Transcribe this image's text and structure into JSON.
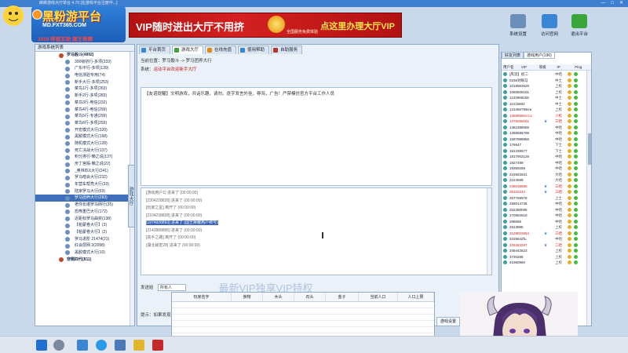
{
  "window": {
    "title": "麻將游戏大厅单台 4.70 [在游戏平台注册中...]",
    "controls": [
      "—",
      "□",
      "✕"
    ]
  },
  "logo": {
    "line1": "黑粉游平台",
    "line2": "MD.FXT365.COM",
    "line3": "2019 呼我互助 国王奇牌"
  },
  "vip_banner": {
    "left_text": "VIP随时进出大厅不用挤",
    "right_text": "点这里办理大厅VIP",
    "seal_text": "全国服务免费体验"
  },
  "toolbar": [
    {
      "label": "系统设置",
      "icon": "settings-icon",
      "color": "#6b8fb8"
    },
    {
      "label": "访问官网",
      "icon": "globe-icon",
      "color": "#3b86d4"
    },
    {
      "label": "退出平台",
      "icon": "exit-icon",
      "color": "#3aa53a"
    }
  ],
  "left_panel": {
    "header": "游戏系统列表",
    "side_tab": "游戏大厅",
    "items": [
      {
        "label": "罗马骰斗(4892)",
        "type": "root"
      },
      {
        "label": "300级初行-多项(333)",
        "type": "sub"
      },
      {
        "label": "广东中行-多项(139)",
        "type": "sub"
      },
      {
        "label": "电信测验专用(74)",
        "type": "sub"
      },
      {
        "label": "新手大行-多项(253)",
        "type": "sub"
      },
      {
        "label": "菜鸟1行-多项(263)",
        "type": "sub"
      },
      {
        "label": "新手2行-多项(283)",
        "type": "sub"
      },
      {
        "label": "菜鸟3行-电信(232)",
        "type": "sub"
      },
      {
        "label": "菜鸟4行-电信(299)",
        "type": "sub"
      },
      {
        "label": "菜鸟5行-专通(299)",
        "type": "sub"
      },
      {
        "label": "菜鸟6行-多项(293)",
        "type": "sub"
      },
      {
        "label": "开宏模式大行(320)",
        "type": "sub"
      },
      {
        "label": "黑胶模式大行(168)",
        "type": "sub"
      },
      {
        "label": "随机模式大行(128)",
        "type": "sub"
      },
      {
        "label": "死亡决战大行(137)",
        "type": "sub"
      },
      {
        "label": "积分排行-懒之说(137)",
        "type": "sub"
      },
      {
        "label": "卅丁宫殿-懒之说(22)",
        "type": "sub"
      },
      {
        "label": "_奥林匹X大行(241)",
        "type": "sub"
      },
      {
        "label": "罗马暗会大行(232)",
        "type": "sub"
      },
      {
        "label": "年营车帮亮大行(33)",
        "type": "sub"
      },
      {
        "label": "陆家罗马大行(69)",
        "type": "sub"
      },
      {
        "label": "罗马团养大行(283)",
        "type": "sub",
        "selected": true
      },
      {
        "label": "老你长堪罗马网行(35)",
        "type": "sub"
      },
      {
        "label": "恐怖重巴大行(172)",
        "type": "sub"
      },
      {
        "label": "近距标罗马曲奖(138)",
        "type": "sub"
      },
      {
        "label": "【帕蒙卷大行】(3)",
        "type": "sub"
      },
      {
        "label": "【帕蒙卷大行】(2)",
        "type": "sub"
      },
      {
        "label": "罗马进阶 21474(21)",
        "type": "sub"
      },
      {
        "label": "红会层网 2(2098)",
        "type": "sub"
      },
      {
        "label": "黑胶模式大行(10)",
        "type": "sub"
      },
      {
        "label": "穿题四代(811)",
        "type": "root"
      }
    ]
  },
  "tabs": [
    {
      "label": "平台首页",
      "icon_color": "#3b86d4"
    },
    {
      "label": "游戏大厅",
      "icon_color": "#3aa53a",
      "active": true
    },
    {
      "label": "在线充值",
      "icon_color": "#e38a12"
    },
    {
      "label": "使用帮助",
      "icon_color": "#3b86d4"
    },
    {
      "label": "自助服务",
      "icon_color": "#b83333"
    }
  ],
  "breadcrumb": "当前位置：罗马骰斗 -> 罗马团养大行",
  "notice": {
    "label": "系统：",
    "text": "运动平台欢迎新手大厅"
  },
  "info_text": "【友谊提醒】文明游戏，共话乐趣，请勿。逐字发言外挂，辱骂，广告！严禁模仿官方平台工作人员",
  "chat_lines": [
    {
      "text": "[游戏用户1]  进来了 (00:00:00)",
      "hl": false
    },
    {
      "text": "[2304228828]  进来了 (00:00:00)",
      "hl": false
    },
    {
      "text": "[玩家之星]  离开了 (00:00:00)",
      "hl": false
    },
    {
      "text": "[2104238828]  进来了 (00:00:00)",
      "hl": false
    },
    {
      "text": "[1974928893] 进来了 (国王荣耀用户称号)",
      "hl": true
    },
    {
      "text": "[2142888895]  进来了 (00:00:00)",
      "hl": false
    },
    {
      "text": "[高手之路]  离开了 (00:00:00)",
      "hl": false
    },
    {
      "text": "[湖北秘密28]  进来了 (00:00:00)",
      "hl": false
    }
  ],
  "send_row": {
    "label": "发送给",
    "target": "所有人",
    "tip": "最新VIP独享VIP特权"
  },
  "hint": "提示：如果发现骗子请联系管理员",
  "right_panel": {
    "tabs": [
      {
        "label": "好友列表"
      },
      {
        "label": "游戏用户(196)",
        "active": true
      }
    ],
    "columns": [
      "用户名",
      "VIP",
      "等级",
      "IP",
      "Ping"
    ],
    "users": [
      {
        "name": "[风流】初二",
        "vip": "",
        "level": "中哈",
        "red": false
      },
      {
        "name": "0236对眼马",
        "vip": "",
        "level": "中士",
        "red": false
      },
      {
        "name": "1018963525",
        "vip": "",
        "level": "上校",
        "red": false
      },
      {
        "name": "1060508181",
        "vip": "",
        "level": "上校",
        "red": false
      },
      {
        "name": "1133969256",
        "vip": "",
        "level": "中士",
        "red": false
      },
      {
        "name": "11215902",
        "vip": "",
        "level": "中士",
        "red": false
      },
      {
        "name": "123456789ice",
        "vip": "",
        "level": "上校",
        "red": false
      },
      {
        "name": "1366956ecccc",
        "vip": "",
        "level": "少校",
        "red": true
      },
      {
        "name": "1379256181",
        "vip": "♛",
        "level": "三哈",
        "red": true
      },
      {
        "name": "1382398085",
        "vip": "",
        "level": "中哈",
        "red": false
      },
      {
        "name": "1396586789",
        "vip": "",
        "level": "中哈",
        "red": false
      },
      {
        "name": "1597999866",
        "vip": "",
        "level": "中哈",
        "red": false
      },
      {
        "name": "176647",
        "vip": "",
        "level": "下士",
        "red": false
      },
      {
        "name": "181339577",
        "vip": "",
        "level": "下士",
        "red": false
      },
      {
        "name": "1817902128",
        "vip": "",
        "level": "中哈",
        "red": false
      },
      {
        "name": "1827489",
        "vip": "",
        "level": "中哈",
        "red": false
      },
      {
        "name": "19369289",
        "vip": "",
        "level": "中哈",
        "red": false
      },
      {
        "name": "215922631",
        "vip": "",
        "level": "大哈",
        "red": false
      },
      {
        "name": "2224599",
        "vip": "",
        "level": "大哈",
        "red": false
      },
      {
        "name": "239108695",
        "vip": "♛",
        "level": "三哈",
        "red": true
      },
      {
        "name": "25102342",
        "vip": "♛",
        "level": "三哈",
        "red": true
      },
      {
        "name": "257769978",
        "vip": "",
        "level": "上士",
        "red": false
      },
      {
        "name": "258014736",
        "vip": "",
        "level": "中哈",
        "red": false
      },
      {
        "name": "262390095",
        "vip": "",
        "level": "中哈",
        "red": false
      },
      {
        "name": "270952519",
        "vip": "",
        "level": "中哈",
        "red": false
      },
      {
        "name": "286666",
        "vip": "",
        "level": "中哈",
        "red": false
      },
      {
        "name": "2813995",
        "vip": "",
        "level": "上校",
        "red": false
      },
      {
        "name": "3129810654",
        "vip": "♛",
        "level": "三哈",
        "red": true
      },
      {
        "name": "322564Zfu",
        "vip": "",
        "level": "中哈",
        "red": false
      },
      {
        "name": "325463287",
        "vip": "♛",
        "level": "二哈",
        "red": true
      },
      {
        "name": "349442823",
        "vip": "",
        "level": "上校",
        "red": false
      },
      {
        "name": "3730288",
        "vip": "",
        "level": "上校",
        "red": false
      },
      {
        "name": "41960960",
        "vip": "",
        "level": "上校",
        "red": false
      }
    ]
  },
  "bottom_table": {
    "columns": [
      "玩家名字",
      "食物",
      "木头",
      "石头",
      "金子",
      "当前人口",
      "人口上限"
    ]
  },
  "bottom_button": "游戏设置",
  "taskbar_icons": [
    "windows-start-icon",
    "search-icon",
    "mail-icon",
    "browser-icon",
    "task-view-icon",
    "folder-icon",
    "game-icon"
  ]
}
